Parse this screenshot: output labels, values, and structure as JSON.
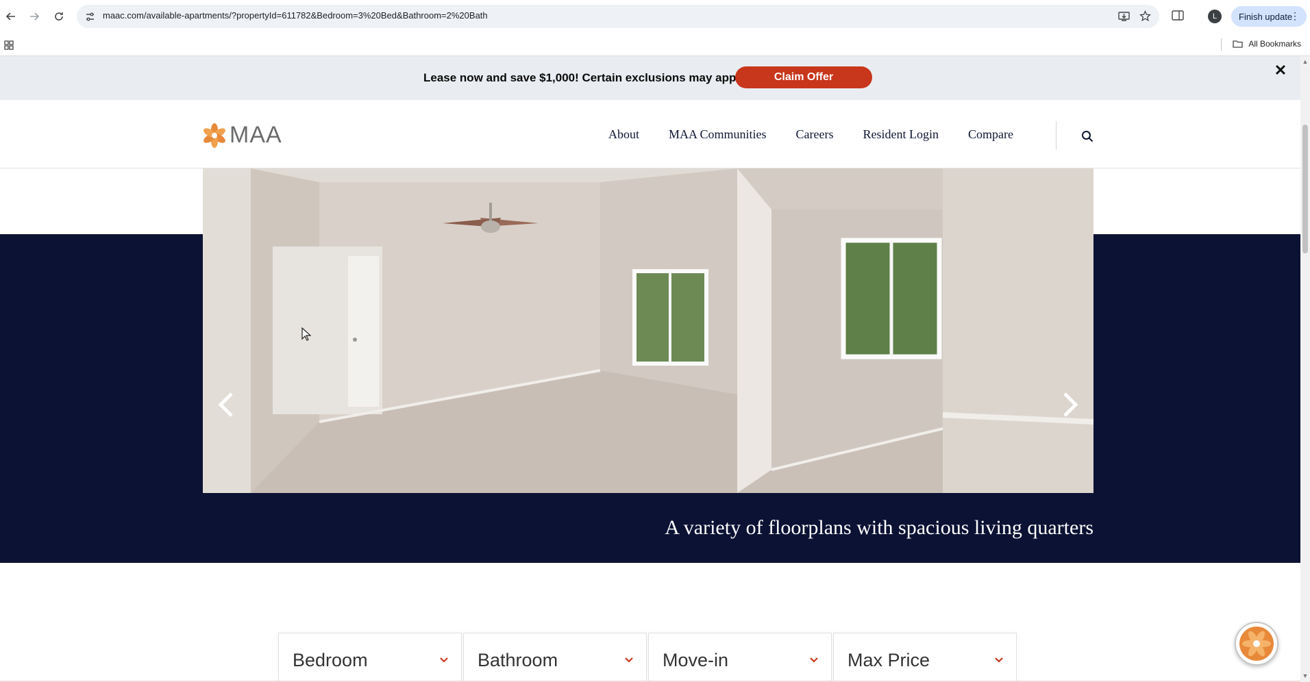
{
  "browser": {
    "url": "maac.com/available-apartments/?propertyId=611782&Bedroom=3%20Bed&Bathroom=2%20Bath",
    "finish_update_label": "Finish update",
    "profile_initial": "L",
    "all_bookmarks_label": "All Bookmarks"
  },
  "promo": {
    "text": "Lease now and save $1,000! Certain exclusions may apply.",
    "cta_label": "Claim Offer",
    "close_symbol": "✕"
  },
  "header": {
    "logo_text": "MAA",
    "nav": [
      "About",
      "MAA Communities",
      "Careers",
      "Resident Login",
      "Compare"
    ]
  },
  "hero": {
    "caption": "A variety of floorplans with spacious living quarters"
  },
  "filters": [
    "Bedroom",
    "Bathroom",
    "Move-in",
    "Max Price"
  ],
  "colors": {
    "navy": "#0b1233",
    "accent_red": "#c8361b",
    "logo_orange": "#e8893a"
  }
}
